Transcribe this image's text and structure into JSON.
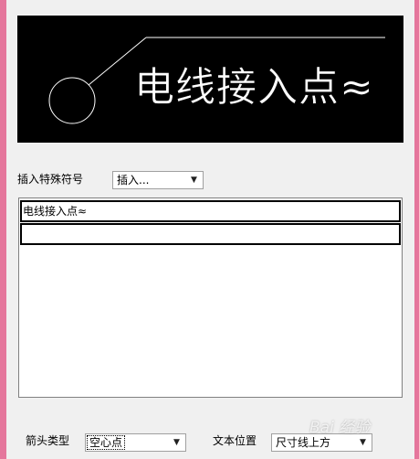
{
  "preview": {
    "text": "电线接入点≈",
    "text_color": "#ffffff",
    "background": "#000000"
  },
  "insert_symbol": {
    "label": "插入特殊符号",
    "select_value": "插入..."
  },
  "text_list": {
    "rows": [
      "电线接入点≈",
      ""
    ]
  },
  "arrow_type": {
    "label": "箭头类型",
    "select_value": "空心点"
  },
  "text_position": {
    "label": "文本位置",
    "select_value": "尺寸线上方"
  },
  "watermark": {
    "text": "Bai 经验"
  }
}
